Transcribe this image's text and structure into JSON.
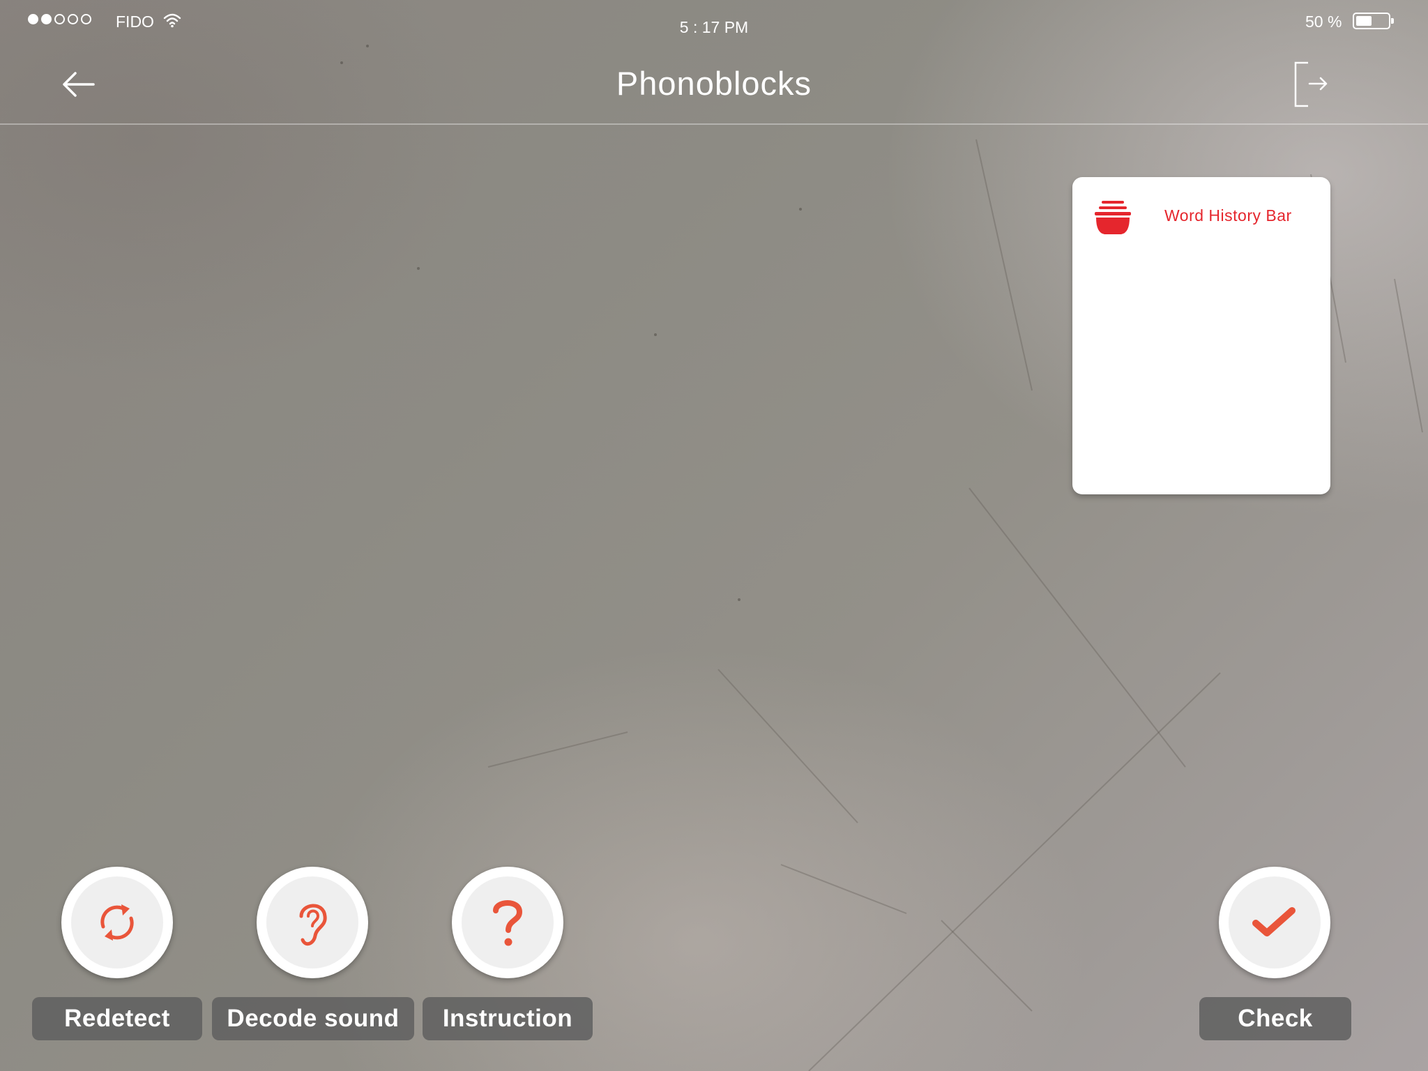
{
  "status_bar": {
    "carrier": "FIDO",
    "signal_strength": 2,
    "signal_total": 5,
    "time": "5 : 17 PM",
    "battery_text": "50 %",
    "battery_level": 0.5
  },
  "nav": {
    "title": "Phonoblocks",
    "back_icon": "arrow-left-icon",
    "exit_icon": "logout-icon"
  },
  "history_card": {
    "title": "Word History Bar",
    "icon": "stacked-bowl-icon",
    "accent_color": "#e5262d",
    "words": []
  },
  "actions": {
    "redetect": {
      "label": "Redetect",
      "icon": "refresh-icon"
    },
    "decode": {
      "label": "Decode sound",
      "icon": "ear-icon"
    },
    "instruction": {
      "label": "Instruction",
      "icon": "question-icon"
    },
    "check": {
      "label": "Check",
      "icon": "checkmark-icon"
    }
  },
  "colors": {
    "icon_accent": "#e9553a",
    "label_bg": "#5f5f5f"
  }
}
